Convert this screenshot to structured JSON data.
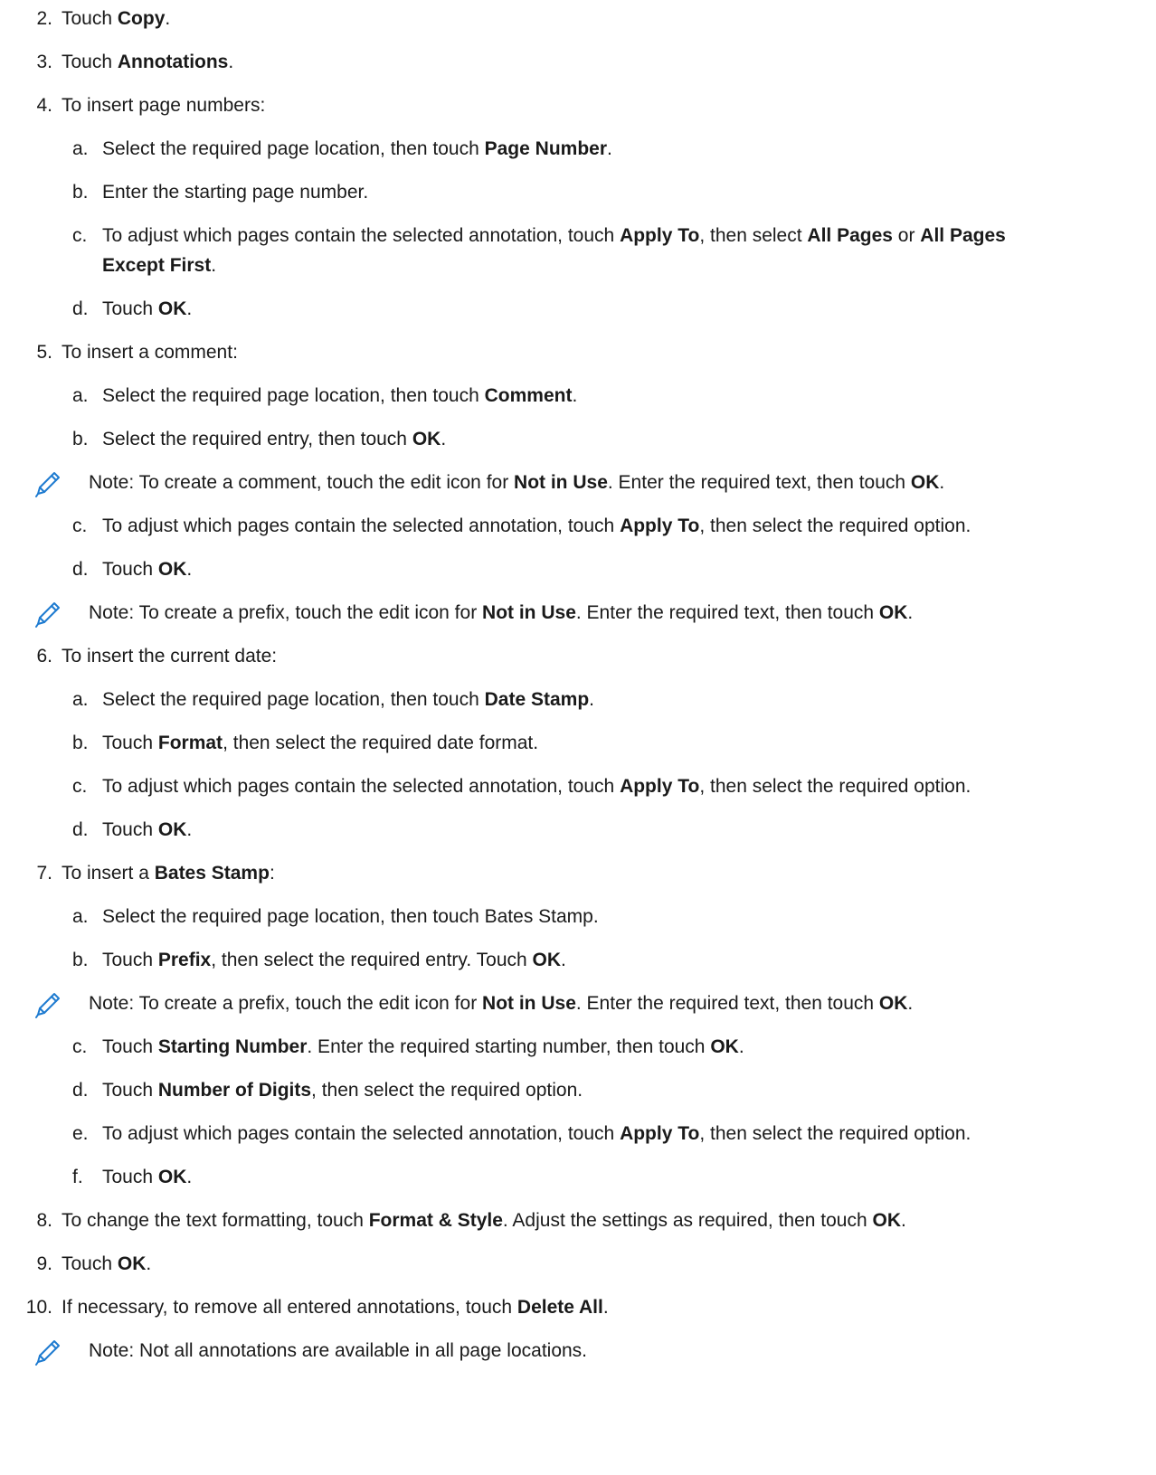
{
  "steps": [
    {
      "num": "2.",
      "text": [
        [
          "Touch ",
          0
        ],
        [
          "Copy",
          1
        ],
        [
          ".",
          0
        ]
      ]
    },
    {
      "num": "3.",
      "text": [
        [
          "Touch ",
          0
        ],
        [
          "Annotations",
          1
        ],
        [
          ".",
          0
        ]
      ]
    },
    {
      "num": "4.",
      "text": [
        [
          "To insert page numbers:",
          0
        ]
      ]
    },
    {
      "num": "a.",
      "text": [
        [
          "Select the required page location, then touch ",
          0
        ],
        [
          "Page Number",
          1
        ],
        [
          ".",
          0
        ]
      ]
    },
    {
      "num": "b.",
      "text": [
        [
          "Enter the starting page number.",
          0
        ]
      ]
    },
    {
      "num": "c.",
      "text": [
        [
          "To adjust which pages contain the selected annotation, touch ",
          0
        ],
        [
          "Apply To",
          1
        ],
        [
          ", then select ",
          0
        ],
        [
          "All Pages",
          1
        ],
        [
          " or ",
          0
        ],
        [
          "All Pages",
          1
        ]
      ]
    },
    {
      "num": "",
      "text": [
        [
          "Except First",
          1
        ],
        [
          ".",
          0
        ]
      ]
    },
    {
      "num": "d.",
      "text": [
        [
          "Touch ",
          0
        ],
        [
          "OK",
          1
        ],
        [
          ".",
          0
        ]
      ]
    },
    {
      "num": "5.",
      "text": [
        [
          "To insert a comment:",
          0
        ]
      ]
    },
    {
      "num": "a.",
      "text": [
        [
          "Select the required page location, then touch ",
          0
        ],
        [
          "Comment",
          1
        ],
        [
          ".",
          0
        ]
      ]
    },
    {
      "num": "b.",
      "text": [
        [
          "Select the required entry, then touch ",
          0
        ],
        [
          "OK",
          1
        ],
        [
          ".",
          0
        ]
      ]
    },
    {
      "num": "",
      "text": [
        [
          "Note: To create a comment, touch the edit icon for ",
          0
        ],
        [
          "Not in Use",
          1
        ],
        [
          ". Enter the required text, then touch ",
          0
        ],
        [
          "OK",
          1
        ],
        [
          ".",
          0
        ]
      ]
    },
    {
      "num": "c.",
      "text": [
        [
          "To adjust which pages contain the selected annotation, touch ",
          0
        ],
        [
          "Apply To",
          1
        ],
        [
          ", then select the required option.",
          0
        ]
      ]
    },
    {
      "num": "d.",
      "text": [
        [
          "Touch ",
          0
        ],
        [
          "OK",
          1
        ],
        [
          ".",
          0
        ]
      ]
    },
    {
      "num": "",
      "text": [
        [
          "Note: To create a prefix, touch the edit icon for ",
          0
        ],
        [
          "Not in Use",
          1
        ],
        [
          ". Enter the required text, then touch ",
          0
        ],
        [
          "OK",
          1
        ],
        [
          ".",
          0
        ]
      ]
    },
    {
      "num": "6.",
      "text": [
        [
          "To insert the current date:",
          0
        ]
      ]
    },
    {
      "num": "a.",
      "text": [
        [
          "Select the required page location, then touch ",
          0
        ],
        [
          "Date Stamp",
          1
        ],
        [
          ".",
          0
        ]
      ]
    },
    {
      "num": "b.",
      "text": [
        [
          "Touch ",
          0
        ],
        [
          "Format",
          1
        ],
        [
          ", then select the required date format.",
          0
        ]
      ]
    },
    {
      "num": "c.",
      "text": [
        [
          "To adjust which pages contain the selected annotation, touch ",
          0
        ],
        [
          "Apply To",
          1
        ],
        [
          ", then select the required option.",
          0
        ]
      ]
    },
    {
      "num": "d.",
      "text": [
        [
          "Touch ",
          0
        ],
        [
          "OK",
          1
        ],
        [
          ".",
          0
        ]
      ]
    },
    {
      "num": "7.",
      "text": [
        [
          "To insert a ",
          0
        ],
        [
          "Bates Stamp",
          1
        ],
        [
          ":",
          0
        ]
      ]
    },
    {
      "num": "a.",
      "text": [
        [
          "Select the required page location, then touch Bates Stamp.",
          0
        ]
      ]
    },
    {
      "num": "b.",
      "text": [
        [
          "Touch ",
          0
        ],
        [
          "Prefix",
          1
        ],
        [
          ", then select the required entry. Touch ",
          0
        ],
        [
          "OK",
          1
        ],
        [
          ".",
          0
        ]
      ]
    },
    {
      "num": "",
      "text": [
        [
          "Note: To create a prefix, touch the edit icon for ",
          0
        ],
        [
          "Not in Use",
          1
        ],
        [
          ". Enter the required text, then touch ",
          0
        ],
        [
          "OK",
          1
        ],
        [
          ".",
          0
        ]
      ]
    },
    {
      "num": "c.",
      "text": [
        [
          "Touch ",
          0
        ],
        [
          "Starting Number",
          1
        ],
        [
          ". Enter the required starting number, then touch ",
          0
        ],
        [
          "OK",
          1
        ],
        [
          ".",
          0
        ]
      ]
    },
    {
      "num": "d.",
      "text": [
        [
          "Touch ",
          0
        ],
        [
          "Number of Digits",
          1
        ],
        [
          ", then select the required option.",
          0
        ]
      ]
    },
    {
      "num": "e.",
      "text": [
        [
          "To adjust which pages contain the selected annotation, touch ",
          0
        ],
        [
          "Apply To",
          1
        ],
        [
          ", then select the required option.",
          0
        ]
      ]
    },
    {
      "num": "f.",
      "text": [
        [
          "Touch ",
          0
        ],
        [
          "OK",
          1
        ],
        [
          ".",
          0
        ]
      ]
    },
    {
      "num": "8.",
      "text": [
        [
          "To change the text formatting, touch ",
          0
        ],
        [
          "Format & Style",
          1
        ],
        [
          ". Adjust the settings as required, then touch ",
          0
        ],
        [
          "OK",
          1
        ],
        [
          ".",
          0
        ]
      ]
    },
    {
      "num": "9.",
      "text": [
        [
          "Touch ",
          0
        ],
        [
          "OK",
          1
        ],
        [
          ".",
          0
        ]
      ]
    },
    {
      "num": "10.",
      "text": [
        [
          "If necessary, to remove all entered annotations, touch ",
          0
        ],
        [
          "Delete All",
          1
        ],
        [
          ".",
          0
        ]
      ]
    },
    {
      "num": "",
      "text": [
        [
          "Note: Not all annotations are available in all page locations.",
          0
        ]
      ]
    }
  ],
  "icons": {
    "note": "pencil-icon",
    "color": "#1e7bd0"
  }
}
